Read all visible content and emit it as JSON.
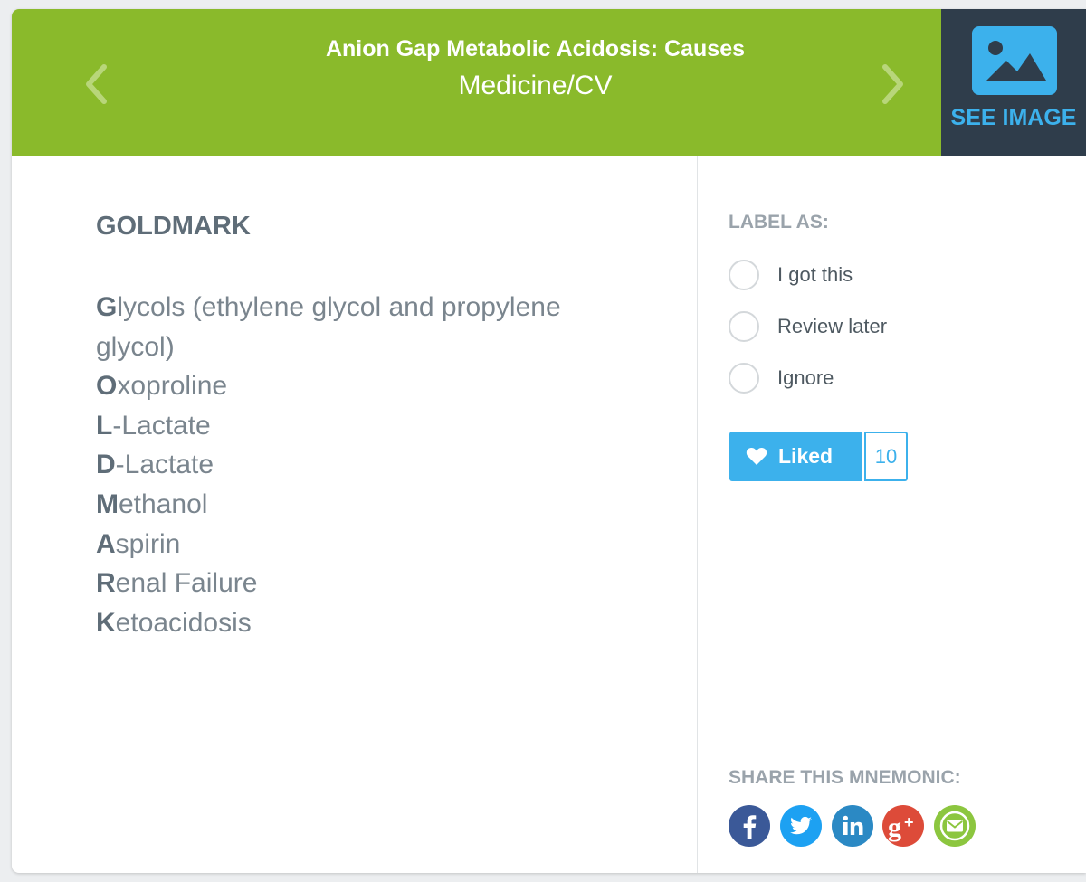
{
  "header": {
    "title": "Anion Gap Metabolic Acidosis: Causes",
    "category": "Medicine/CV",
    "prev_icon": "chevron-left-icon",
    "next_icon": "chevron-right-icon",
    "see_image_label": "SEE IMAGE",
    "see_image_icon": "image-icon"
  },
  "colors": {
    "header_bg": "#8aba2b",
    "see_image_bg": "#2f3d4b",
    "accent": "#3cb1ec"
  },
  "mnemonic": {
    "title": "GOLDMARK",
    "items": [
      {
        "initial": "G",
        "rest": "lycols (ethylene glycol and propylene glycol)"
      },
      {
        "initial": "O",
        "rest": "xoproline"
      },
      {
        "initial": "L",
        "rest": "-Lactate"
      },
      {
        "initial": "D",
        "rest": "-Lactate"
      },
      {
        "initial": "M",
        "rest": "ethanol"
      },
      {
        "initial": "A",
        "rest": "spirin"
      },
      {
        "initial": "R",
        "rest": "enal Failure"
      },
      {
        "initial": "K",
        "rest": "etoacidosis"
      }
    ]
  },
  "sidebar": {
    "label_heading": "LABEL AS:",
    "options": [
      {
        "label": "I got this"
      },
      {
        "label": "Review later"
      },
      {
        "label": "Ignore"
      }
    ],
    "like": {
      "label": "Liked",
      "count": "10",
      "icon": "heart-icon"
    },
    "share_heading": "SHARE THIS MNEMONIC:",
    "share_icons": [
      "facebook-icon",
      "twitter-icon",
      "linkedin-icon",
      "google-plus-icon",
      "email-icon"
    ]
  }
}
